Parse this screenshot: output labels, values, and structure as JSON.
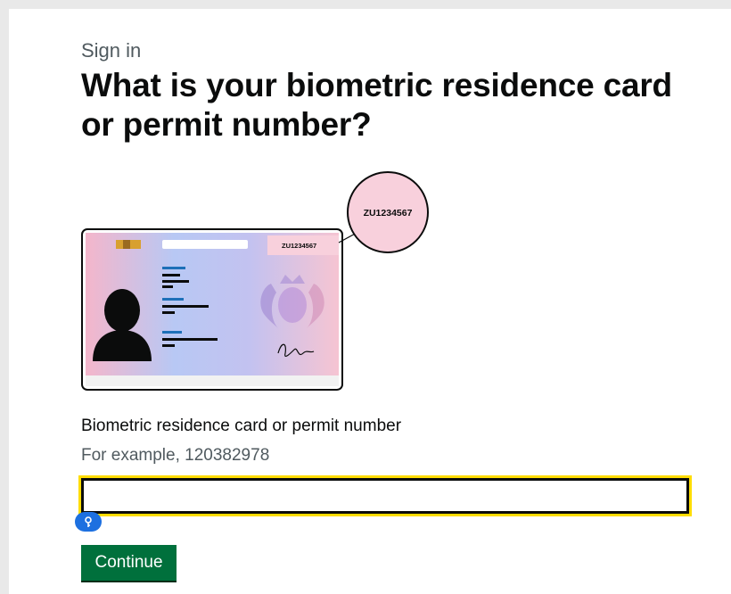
{
  "page": {
    "caption": "Sign in",
    "heading": "What is your biometric residence card or permit number?"
  },
  "illustration": {
    "magnified_number": "ZU1234567",
    "card_number": "ZU1234567"
  },
  "form": {
    "label": "Biometric residence card or permit number",
    "hint": "For example, 120382978",
    "input_value": "",
    "continue_label": "Continue"
  },
  "colors": {
    "button_green": "#00703c",
    "focus_yellow": "#ffdd00",
    "text_black": "#0b0c0c",
    "hint_grey": "#505a5f"
  }
}
